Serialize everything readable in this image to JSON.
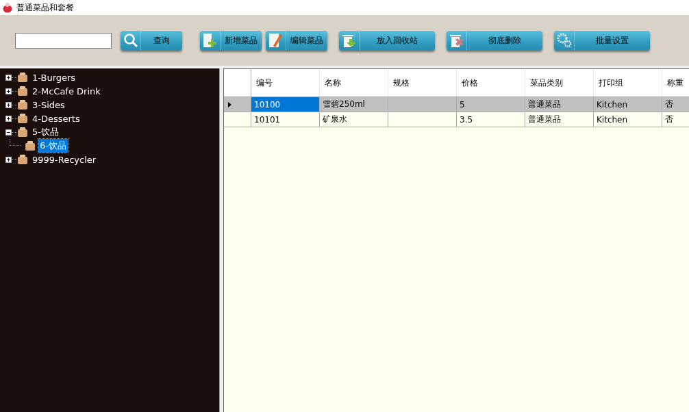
{
  "window": {
    "title": "普通菜品和套餐"
  },
  "toolbar": {
    "buttons": [
      {
        "kind": "search",
        "label": "查询"
      },
      {
        "kind": "add",
        "label": "新增菜品"
      },
      {
        "kind": "edit",
        "label": "编辑菜品"
      },
      {
        "kind": "recycle",
        "label": "放入回收站"
      },
      {
        "kind": "delete",
        "label": "彻底删除"
      },
      {
        "kind": "settings",
        "label": "批量设置"
      }
    ]
  },
  "tree": [
    {
      "label": "1-Burgers",
      "expanded": false,
      "selected": false
    },
    {
      "label": "2-McCafe Drink",
      "expanded": false,
      "selected": false
    },
    {
      "label": "3-Sides",
      "expanded": false,
      "selected": false
    },
    {
      "label": "4-Desserts",
      "expanded": false,
      "selected": false
    },
    {
      "label": "5-饮品",
      "expanded": true,
      "selected": false,
      "children": [
        {
          "label": "6-饮品",
          "selected": true
        }
      ]
    },
    {
      "label": "9999-Recycler",
      "expanded": false,
      "selected": false
    }
  ],
  "table": {
    "columns": [
      "编号",
      "名称",
      "规格",
      "价格",
      "菜品类别",
      "打印组",
      "称重"
    ],
    "rows": [
      {
        "selected": true,
        "cells": [
          "10100",
          "雪碧250ml",
          null,
          "5",
          "普通菜品",
          "Kitchen",
          "否"
        ]
      },
      {
        "selected": false,
        "cells": [
          "10101",
          "矿泉水",
          null,
          "3.5",
          "普通菜品",
          "Kitchen",
          "否"
        ]
      }
    ]
  }
}
